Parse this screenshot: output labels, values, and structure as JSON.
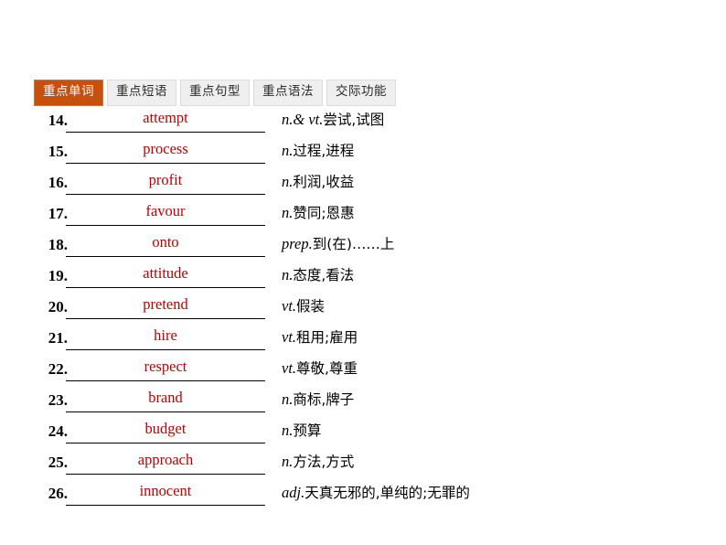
{
  "tabs": [
    {
      "label": "重点单词",
      "active": true
    },
    {
      "label": "重点短语",
      "active": false
    },
    {
      "label": "重点句型",
      "active": false
    },
    {
      "label": "重点语法",
      "active": false
    },
    {
      "label": "交际功能",
      "active": false
    }
  ],
  "colors": {
    "active_tab_bg": "#c8500f",
    "active_tab_border": "#e0731f",
    "active_tab_text": "#ffffff",
    "inactive_tab_bg": "#efefef",
    "inactive_tab_text": "#2b2b2b",
    "answer_red": "#c00000",
    "page_bg": "#ffffff"
  },
  "words": [
    {
      "number": "14.",
      "answer": "attempt",
      "pos": "n.& vt.",
      "meaning": "尝试,试图"
    },
    {
      "number": "15.",
      "answer": "process",
      "pos": "n.",
      "meaning": "过程,进程"
    },
    {
      "number": "16.",
      "answer": "profit",
      "pos": "n.",
      "meaning": "利润,收益"
    },
    {
      "number": "17.",
      "answer": "favour",
      "pos": "n.",
      "meaning": "赞同;恩惠"
    },
    {
      "number": "18.",
      "answer": "onto",
      "pos": "prep.",
      "meaning": "到(在)……上"
    },
    {
      "number": "19.",
      "answer": "attitude",
      "pos": "n.",
      "meaning": "态度,看法"
    },
    {
      "number": "20.",
      "answer": "pretend",
      "pos": "vt.",
      "meaning": "假装"
    },
    {
      "number": "21.",
      "answer": "hire",
      "pos": "vt.",
      "meaning": "租用;雇用"
    },
    {
      "number": "22.",
      "answer": "respect",
      "pos": "vt.",
      "meaning": "尊敬,尊重"
    },
    {
      "number": "23.",
      "answer": "brand",
      "pos": "n.",
      "meaning": "商标,牌子"
    },
    {
      "number": "24.",
      "answer": "budget",
      "pos": "n.",
      "meaning": "预算"
    },
    {
      "number": "25.",
      "answer": "approach",
      "pos": "n.",
      "meaning": "方法,方式"
    },
    {
      "number": "26.",
      "answer": "innocent",
      "pos": "adj.",
      "meaning": "天真无邪的,单纯的;无罪的"
    }
  ]
}
